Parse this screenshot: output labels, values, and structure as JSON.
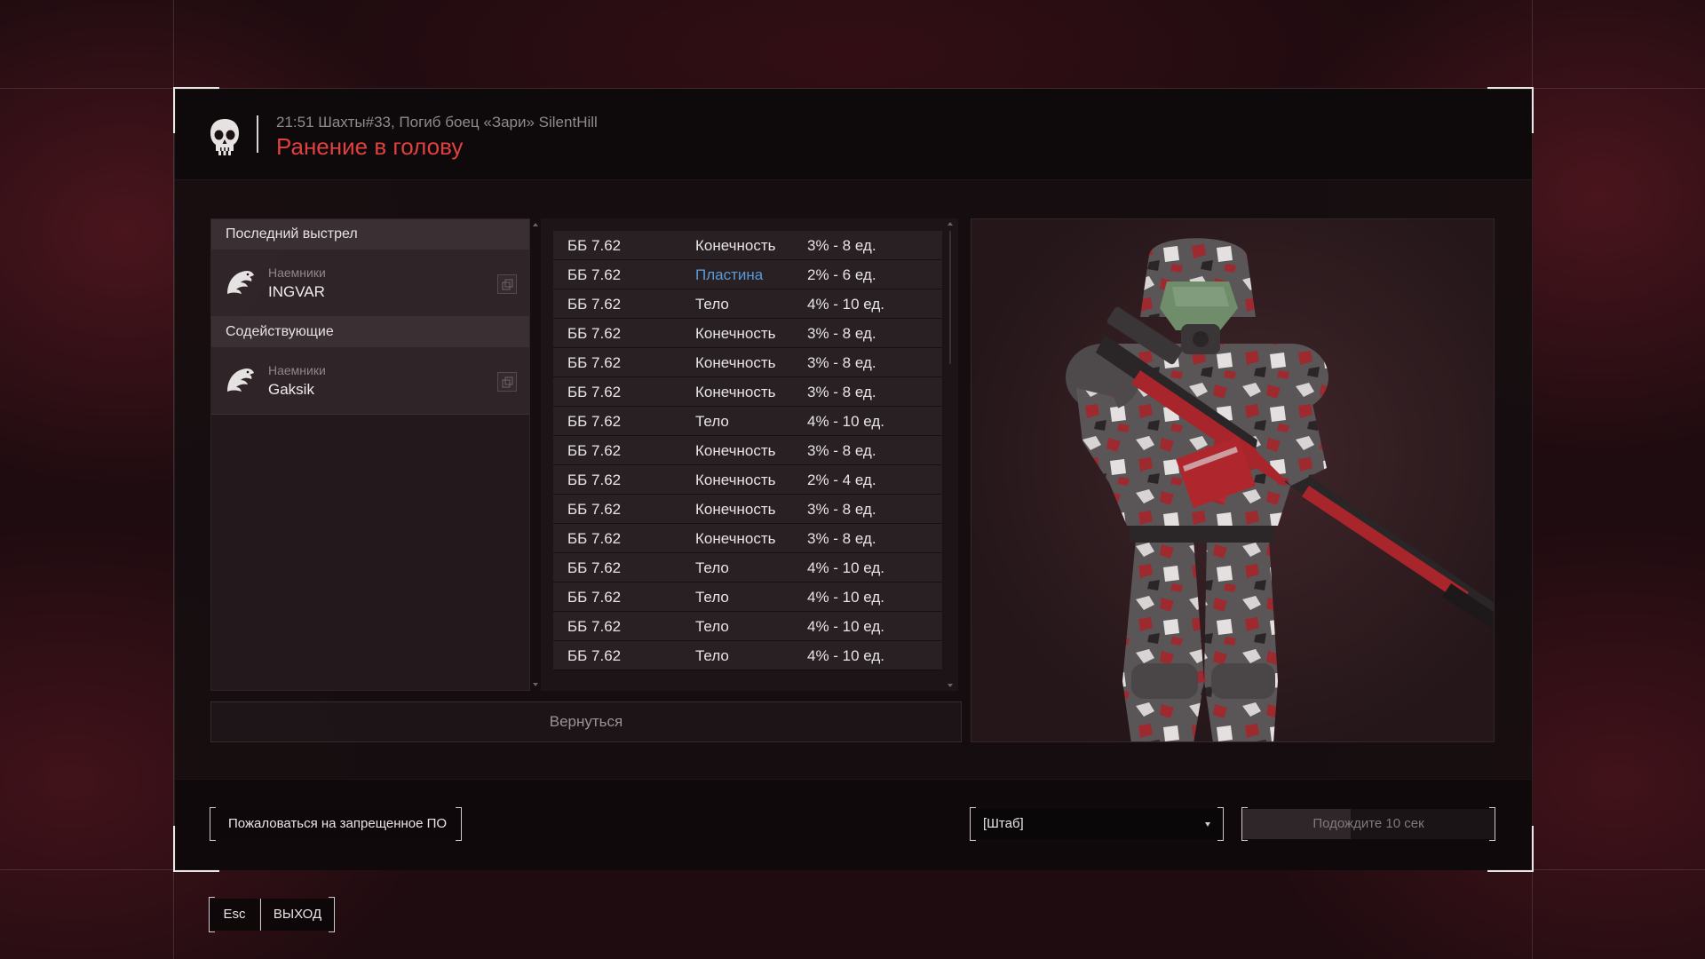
{
  "header": {
    "subtitle": "21:51 Шахты#33, Погиб боец «Зари» SilentHill",
    "title": "Ранение в голову",
    "icon": "skull-icon"
  },
  "left_panel": {
    "last_shot_title": "Последний выстрел",
    "killer": {
      "faction": "Наемники",
      "name": "INGVAR"
    },
    "assists_title": "Содействующие",
    "assists": [
      {
        "faction": "Наемники",
        "name": "Gaksik"
      }
    ]
  },
  "hits": [
    {
      "ammo": "ББ 7.62",
      "zone": "Конечность",
      "damage": "3% - 8 ед."
    },
    {
      "ammo": "ББ 7.62",
      "zone": "Пластина",
      "damage": "2% - 6 ед."
    },
    {
      "ammo": "ББ 7.62",
      "zone": "Тело",
      "damage": "4% - 10 ед."
    },
    {
      "ammo": "ББ 7.62",
      "zone": "Конечность",
      "damage": "3% - 8 ед."
    },
    {
      "ammo": "ББ 7.62",
      "zone": "Конечность",
      "damage": "3% - 8 ед."
    },
    {
      "ammo": "ББ 7.62",
      "zone": "Конечность",
      "damage": "3% - 8 ед."
    },
    {
      "ammo": "ББ 7.62",
      "zone": "Тело",
      "damage": "4% - 10 ед."
    },
    {
      "ammo": "ББ 7.62",
      "zone": "Конечность",
      "damage": "3% - 8 ед."
    },
    {
      "ammo": "ББ 7.62",
      "zone": "Конечность",
      "damage": "2% - 4 ед."
    },
    {
      "ammo": "ББ 7.62",
      "zone": "Конечность",
      "damage": "3% - 8 ед."
    },
    {
      "ammo": "ББ 7.62",
      "zone": "Конечность",
      "damage": "3% - 8 ед."
    },
    {
      "ammo": "ББ 7.62",
      "zone": "Тело",
      "damage": "4% - 10 ед."
    },
    {
      "ammo": "ББ 7.62",
      "zone": "Тело",
      "damage": "4% - 10 ед."
    },
    {
      "ammo": "ББ 7.62",
      "zone": "Тело",
      "damage": "4% - 10 ед."
    },
    {
      "ammo": "ББ 7.62",
      "zone": "Тело",
      "damage": "4% - 10 ед."
    }
  ],
  "back_label": "Вернуться",
  "footer": {
    "report_label": "Пожаловаться на запрещенное ПО",
    "spawn_select_value": "[Штаб]",
    "wait_label": "Подождите 10 сек",
    "wait_progress": 0.43
  },
  "exit": {
    "key": "Esc",
    "label": "ВЫХОД"
  },
  "colors": {
    "accent_red": "#e0413f",
    "plate_blue": "#5b9bd8",
    "background": "#1f0c10"
  }
}
